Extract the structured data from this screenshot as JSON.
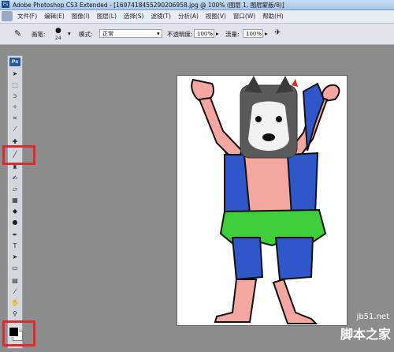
{
  "window": {
    "title": "Adobe Photoshop CS3 Extended - [1697418455290206958.jpg @ 100% (图层 1, 图层蒙版/8)]",
    "app_badge": "Ps"
  },
  "menu": [
    "文件(F)",
    "编辑(E)",
    "图像(I)",
    "图层(L)",
    "选择(S)",
    "滤镜(T)",
    "分析(A)",
    "视图(V)",
    "窗口(W)",
    "帮助(H)"
  ],
  "options": {
    "brush_label": "画笔:",
    "brush_size": "24",
    "mode_label": "模式:",
    "mode_value": "正常",
    "opacity_label": "不透明度:",
    "opacity_value": "100%",
    "flow_label": "流量:",
    "flow_value": "100%"
  },
  "toolbar": {
    "badge": "Ps"
  },
  "watermark": {
    "site": "jb51.net",
    "brand": "脚本之家"
  },
  "colors": {
    "accent_highlight": "#e0282d",
    "foreground": "#000000",
    "background": "#ffffff"
  }
}
